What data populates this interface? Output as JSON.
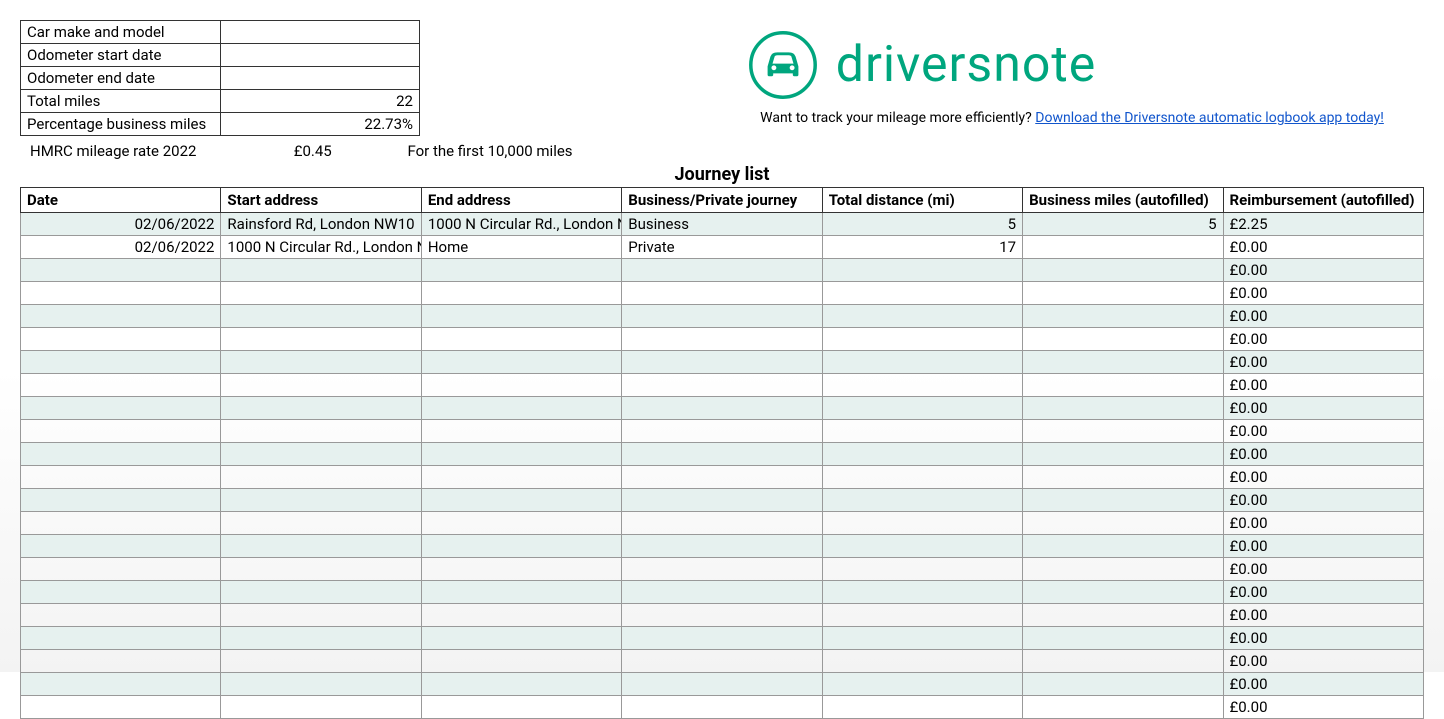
{
  "info": {
    "rows": [
      {
        "label": "Car make and model",
        "value": ""
      },
      {
        "label": "Odometer start date",
        "value": ""
      },
      {
        "label": "Odometer end date",
        "value": ""
      },
      {
        "label": "Total miles",
        "value": "22"
      },
      {
        "label": "Percentage business miles",
        "value": "22.73%"
      }
    ]
  },
  "logo": {
    "text": "driversnote"
  },
  "download": {
    "prefix": "Want to track your mileage more efficiently? ",
    "link": "Download the Driversnote automatic logbook app today!"
  },
  "rate": {
    "label": "HMRC mileage rate 2022",
    "value": "£0.45",
    "note": "For the first 10,000 miles"
  },
  "journey": {
    "title": "Journey list",
    "headers": [
      "Date",
      "Start address",
      "End address",
      "Business/Private journey",
      "Total distance (mi)",
      "Business miles (autofilled)",
      "Reimbursement (autofilled)"
    ],
    "rows": [
      {
        "date": "02/06/2022",
        "start": "Rainsford Rd, London NW10",
        "end": "1000 N Circular Rd., London N",
        "type": "Business",
        "dist": "5",
        "biz": "5",
        "reimb": "£2.25"
      },
      {
        "date": "02/06/2022",
        "start": "1000 N Circular Rd., London N",
        "end": "Home",
        "type": "Private",
        "dist": "17",
        "biz": "",
        "reimb": "£0.00"
      },
      {
        "date": "",
        "start": "",
        "end": "",
        "type": "",
        "dist": "",
        "biz": "",
        "reimb": "£0.00"
      },
      {
        "date": "",
        "start": "",
        "end": "",
        "type": "",
        "dist": "",
        "biz": "",
        "reimb": "£0.00"
      },
      {
        "date": "",
        "start": "",
        "end": "",
        "type": "",
        "dist": "",
        "biz": "",
        "reimb": "£0.00"
      },
      {
        "date": "",
        "start": "",
        "end": "",
        "type": "",
        "dist": "",
        "biz": "",
        "reimb": "£0.00"
      },
      {
        "date": "",
        "start": "",
        "end": "",
        "type": "",
        "dist": "",
        "biz": "",
        "reimb": "£0.00"
      },
      {
        "date": "",
        "start": "",
        "end": "",
        "type": "",
        "dist": "",
        "biz": "",
        "reimb": "£0.00"
      },
      {
        "date": "",
        "start": "",
        "end": "",
        "type": "",
        "dist": "",
        "biz": "",
        "reimb": "£0.00"
      },
      {
        "date": "",
        "start": "",
        "end": "",
        "type": "",
        "dist": "",
        "biz": "",
        "reimb": "£0.00"
      },
      {
        "date": "",
        "start": "",
        "end": "",
        "type": "",
        "dist": "",
        "biz": "",
        "reimb": "£0.00"
      },
      {
        "date": "",
        "start": "",
        "end": "",
        "type": "",
        "dist": "",
        "biz": "",
        "reimb": "£0.00"
      },
      {
        "date": "",
        "start": "",
        "end": "",
        "type": "",
        "dist": "",
        "biz": "",
        "reimb": "£0.00"
      },
      {
        "date": "",
        "start": "",
        "end": "",
        "type": "",
        "dist": "",
        "biz": "",
        "reimb": "£0.00"
      },
      {
        "date": "",
        "start": "",
        "end": "",
        "type": "",
        "dist": "",
        "biz": "",
        "reimb": "£0.00"
      },
      {
        "date": "",
        "start": "",
        "end": "",
        "type": "",
        "dist": "",
        "biz": "",
        "reimb": "£0.00"
      },
      {
        "date": "",
        "start": "",
        "end": "",
        "type": "",
        "dist": "",
        "biz": "",
        "reimb": "£0.00"
      },
      {
        "date": "",
        "start": "",
        "end": "",
        "type": "",
        "dist": "",
        "biz": "",
        "reimb": "£0.00"
      },
      {
        "date": "",
        "start": "",
        "end": "",
        "type": "",
        "dist": "",
        "biz": "",
        "reimb": "£0.00"
      },
      {
        "date": "",
        "start": "",
        "end": "",
        "type": "",
        "dist": "",
        "biz": "",
        "reimb": "£0.00"
      },
      {
        "date": "",
        "start": "",
        "end": "",
        "type": "",
        "dist": "",
        "biz": "",
        "reimb": "£0.00"
      },
      {
        "date": "",
        "start": "",
        "end": "",
        "type": "",
        "dist": "",
        "biz": "",
        "reimb": "£0.00"
      }
    ]
  }
}
